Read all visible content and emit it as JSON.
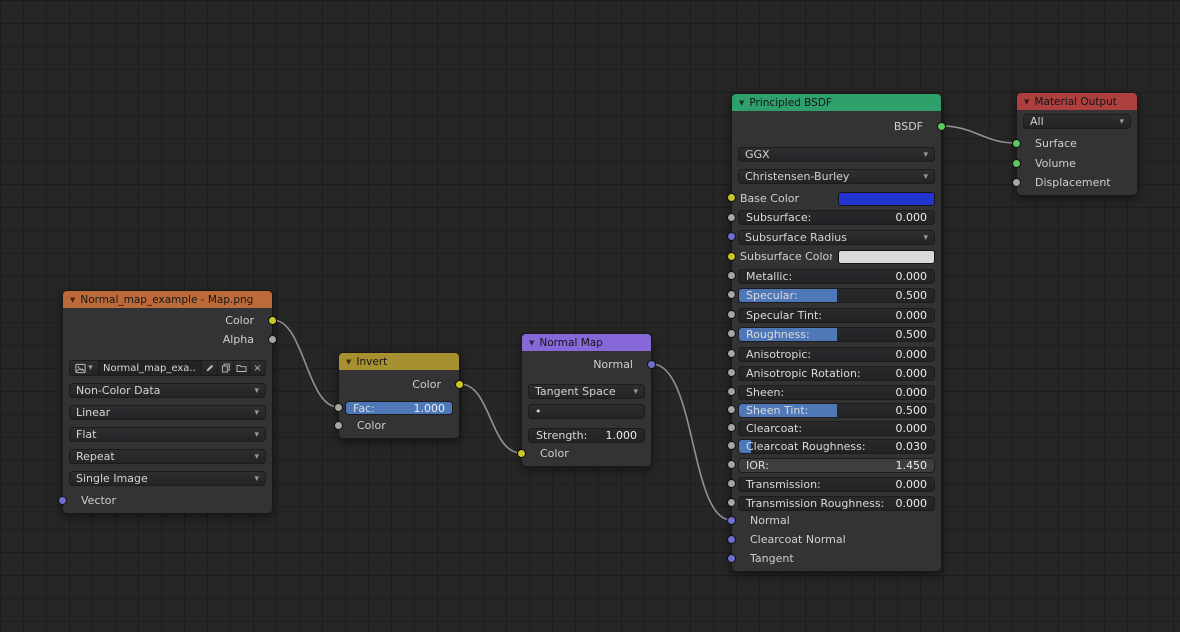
{
  "editor": {
    "background": "#262626",
    "grid_line": "#1e1e1e",
    "wire_color": "#9d9d9d",
    "accent_blue": "#4f78b8",
    "socket_colors": {
      "color": "#c7c729",
      "value": "#a5a5a5",
      "vector": "#6e6ecf",
      "shader": "#5cc75c"
    }
  },
  "glyphs": {
    "collapse": "▼",
    "chevron": "▾",
    "close": "×",
    "dot": "•"
  },
  "nodes": {
    "image": {
      "title": "Normal_map_example - Map.png",
      "header_color": "#bd6a3a",
      "outputs": {
        "color": "Color",
        "alpha": "Alpha"
      },
      "name_field": "Normal_map_exa..",
      "color_space": "Non-Color Data",
      "interpolation": "Linear",
      "projection": "Flat",
      "extension": "Repeat",
      "source": "Single Image",
      "input_vector": "Vector"
    },
    "invert": {
      "title": "Invert",
      "header_color": "#a79030",
      "output_color": "Color",
      "fac_label": "Fac:",
      "fac_value": "1.000",
      "fac_fill_pct": 100,
      "input_color": "Color"
    },
    "normal_map": {
      "title": "Normal Map",
      "header_color": "#8668d8",
      "output_normal": "Normal",
      "space": "Tangent Space",
      "uv_map": "•",
      "strength_label": "Strength:",
      "strength_value": "1.000",
      "input_color": "Color"
    },
    "principled": {
      "title": "Principled BSDF",
      "header_color": "#2fa06c",
      "output": "BSDF",
      "distribution": "GGX",
      "subsurface_method": "Christensen-Burley",
      "rows": [
        {
          "label": "Base Color",
          "type": "color",
          "swatch": "#2335cf"
        },
        {
          "label": "Subsurface:",
          "type": "slider",
          "value": "0.000",
          "fill_pct": 0
        },
        {
          "label": "Subsurface Radius",
          "type": "select"
        },
        {
          "label": "Subsurface Color",
          "type": "color",
          "swatch": "#d9d9d9"
        },
        {
          "label": "Metallic:",
          "type": "slider",
          "value": "0.000",
          "fill_pct": 0
        },
        {
          "label": "Specular:",
          "type": "slider",
          "value": "0.500",
          "fill_pct": 50
        },
        {
          "label": "Specular Tint:",
          "type": "slider",
          "value": "0.000",
          "fill_pct": 0
        },
        {
          "label": "Roughness:",
          "type": "slider",
          "value": "0.500",
          "fill_pct": 50
        },
        {
          "label": "Anisotropic:",
          "type": "slider",
          "value": "0.000",
          "fill_pct": 0
        },
        {
          "label": "Anisotropic Rotation:",
          "type": "slider",
          "value": "0.000",
          "fill_pct": 0
        },
        {
          "label": "Sheen:",
          "type": "slider",
          "value": "0.000",
          "fill_pct": 0
        },
        {
          "label": "Sheen Tint:",
          "type": "slider",
          "value": "0.500",
          "fill_pct": 50
        },
        {
          "label": "Clearcoat:",
          "type": "slider",
          "value": "0.000",
          "fill_pct": 0
        },
        {
          "label": "Clearcoat Roughness:",
          "type": "slider",
          "value": "0.030",
          "fill_pct": 6
        },
        {
          "label": "IOR:",
          "type": "slider",
          "value": "1.450",
          "fill_pct": 0
        },
        {
          "label": "Transmission:",
          "type": "slider",
          "value": "0.000",
          "fill_pct": 0
        },
        {
          "label": "Transmission Roughness:",
          "type": "slider",
          "value": "0.000",
          "fill_pct": 0
        }
      ],
      "inputs": [
        "Normal",
        "Clearcoat Normal",
        "Tangent"
      ]
    },
    "output": {
      "title": "Material Output",
      "header_color": "#ad3f3f",
      "target": "All",
      "inputs": [
        "Surface",
        "Volume",
        "Displacement"
      ]
    }
  },
  "links": [
    {
      "from": "Normal_map_example - Map.png / Color",
      "to": "Invert / Fac"
    },
    {
      "from": "Invert / Color",
      "to": "Normal Map / Color"
    },
    {
      "from": "Normal Map / Normal",
      "to": "Principled BSDF / Normal"
    },
    {
      "from": "Principled BSDF / BSDF",
      "to": "Material Output / Surface"
    }
  ]
}
